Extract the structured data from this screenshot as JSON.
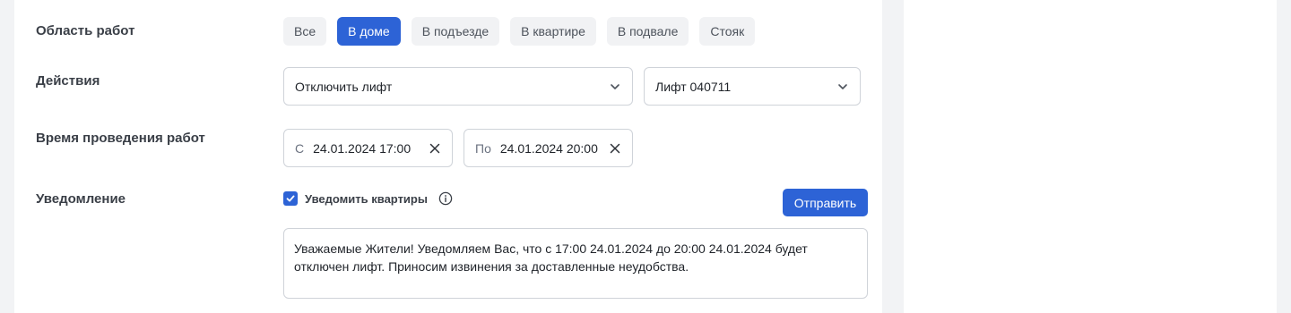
{
  "work_area": {
    "label": "Область работ",
    "options": [
      "Все",
      "В доме",
      "В подъезде",
      "В квартире",
      "В подвале",
      "Стояк"
    ],
    "selected": "В доме"
  },
  "actions": {
    "label": "Действия",
    "action_value": "Отключить лифт",
    "target_value": "Лифт 040711"
  },
  "work_time": {
    "label": "Время проведения работ",
    "from_prefix": "С",
    "from_value": "24.01.2024 17:00",
    "to_prefix": "По",
    "to_value": "24.01.2024 20:00"
  },
  "notification": {
    "label": "Уведомление",
    "checkbox_label": "Уведомить квартиры",
    "checked": true,
    "send_label": "Отправить",
    "message": "Уважаемые Жители! Уведомляем Вас, что с 17:00 24.01.2024 до 20:00 24.01.2024 будет отключен лифт. Приносим извинения за доставленные неудобства."
  },
  "colors": {
    "accent": "#2d63d6",
    "chip_bg": "#f1f2f4",
    "page_bg": "#f2f3f5"
  }
}
